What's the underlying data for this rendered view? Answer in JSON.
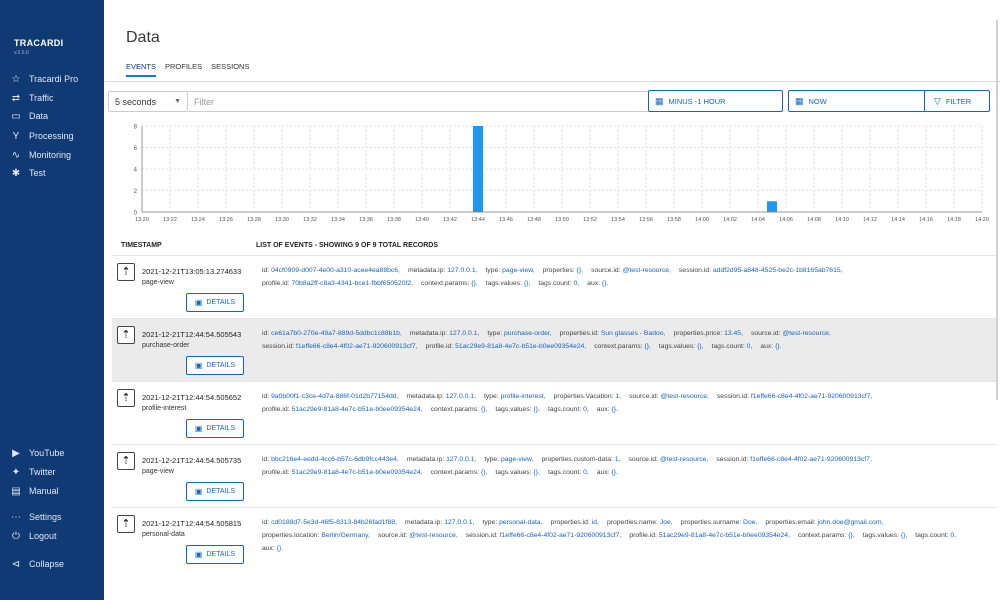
{
  "sidebar": {
    "brand": "TRACARDI",
    "version": "v.0.6.0",
    "items": [
      {
        "label": "Tracardi Pro",
        "icon": "star-icon"
      },
      {
        "label": "Traffic",
        "icon": "traffic-icon"
      },
      {
        "label": "Data",
        "icon": "folder-icon"
      },
      {
        "label": "Processing",
        "icon": "processing-icon"
      },
      {
        "label": "Monitoring",
        "icon": "monitoring-icon"
      },
      {
        "label": "Test",
        "icon": "bug-icon"
      }
    ],
    "bottom_items": [
      {
        "label": "YouTube",
        "icon": "youtube-icon"
      },
      {
        "label": "Twitter",
        "icon": "twitter-icon"
      },
      {
        "label": "Manual",
        "icon": "manual-icon"
      },
      {
        "label": "Settings",
        "icon": "settings-icon"
      },
      {
        "label": "Logout",
        "icon": "logout-icon"
      },
      {
        "label": "Collapse",
        "icon": "collapse-icon"
      }
    ]
  },
  "header": {
    "title": "Data",
    "tabs": [
      "EVENTS",
      "PROFILES",
      "SESSIONS"
    ],
    "active_tab": 0
  },
  "toolbar": {
    "refresh_value": "5 seconds",
    "filter_placeholder": "Filter",
    "from_label": "MINUS -1 HOUR",
    "to_label": "NOW",
    "filter_button": "FILTER"
  },
  "chart_data": {
    "type": "bar",
    "categories": [
      "13:20",
      "13:22",
      "13:24",
      "13:26",
      "13:28",
      "13:30",
      "13:32",
      "13:34",
      "13:36",
      "13:38",
      "13:40",
      "13:42",
      "13:44",
      "13:46",
      "13:48",
      "13:50",
      "13:52",
      "13:54",
      "13:56",
      "13:58",
      "14:00",
      "14:02",
      "14:04",
      "14:06",
      "14:08",
      "14:10",
      "14:12",
      "14:14",
      "14:16",
      "14:18",
      "14:20"
    ],
    "bars": [
      {
        "x": "13:44",
        "value": 8
      },
      {
        "x": "14:05",
        "value": 1
      }
    ],
    "ylim": [
      0,
      8
    ],
    "yticks": [
      0,
      2,
      4,
      6,
      8
    ],
    "grid": true,
    "color": "#2196f3"
  },
  "table": {
    "col_timestamp": "TIMESTAMP",
    "col_events": "LIST OF EVENTS - SHOWING 9 OF 9 TOTAL RECORDS",
    "details_label": "DETAILS",
    "rows": [
      {
        "timestamp": "2021-12-21T13:05:13.274633",
        "type": "page-view",
        "highlight": false,
        "props": [
          {
            "k": "id:",
            "v": "04cf0909-d007-4e00-a310-acee4ea88bc6,"
          },
          {
            "k": "metadata.ip:",
            "v": "127.0.0.1,"
          },
          {
            "k": "type:",
            "v": "page-view,"
          },
          {
            "k": "properties:",
            "v": "{},"
          },
          {
            "k": "source.id:",
            "v": "@test-resource,"
          },
          {
            "k": "session.id:",
            "v": "addf2d95-a848-4525-be2c-1b8165ab7615,"
          },
          {
            "k": "profile.id:",
            "v": "70b8a2ff-c8a3-4341-bce1-fbbf650520f2,"
          },
          {
            "k": "context.params:",
            "v": "{},"
          },
          {
            "k": "tags.values:",
            "v": "{},"
          },
          {
            "k": "tags.count:",
            "v": "0,"
          },
          {
            "k": "aux:",
            "v": "{}."
          }
        ]
      },
      {
        "timestamp": "2021-12-21T12:44:54.505543",
        "type": "purchase-order",
        "highlight": true,
        "props": [
          {
            "k": "id:",
            "v": "ce61a7b0-270e-49a7-889d-5ddbc1c88b1b,"
          },
          {
            "k": "metadata.ip:",
            "v": "127.0.0.1,"
          },
          {
            "k": "type:",
            "v": "purchase-order,"
          },
          {
            "k": "properties.id:",
            "v": "Sun glasses - Badoo,"
          },
          {
            "k": "properties.price:",
            "v": "13.45,"
          },
          {
            "k": "source.id:",
            "v": "@test-resource,"
          },
          {
            "k": "session.id:",
            "v": "f1effe66-c8e4-4f02-ae71-920600913cf7,"
          },
          {
            "k": "profile.id:",
            "v": "51ac29e9-81a8-4e7c-b51e-b0ee09354e24,"
          },
          {
            "k": "context.params:",
            "v": "{},"
          },
          {
            "k": "tags.values:",
            "v": "{},"
          },
          {
            "k": "tags.count:",
            "v": "0,"
          },
          {
            "k": "aux:",
            "v": "{}."
          }
        ]
      },
      {
        "timestamp": "2021-12-21T12:44:54.505652",
        "type": "profile-interest",
        "highlight": false,
        "props": [
          {
            "k": "id:",
            "v": "9a0b00f1-c3ce-4d7a-886f-01d2b77154dd,"
          },
          {
            "k": "metadata.ip:",
            "v": "127.0.0.1,"
          },
          {
            "k": "type:",
            "v": "profile-interest,"
          },
          {
            "k": "properties.Vacation:",
            "v": "1,"
          },
          {
            "k": "source.id:",
            "v": "@test-resource,"
          },
          {
            "k": "session.id:",
            "v": "f1effe66-c8e4-4f02-ae71-920600913cf7,"
          },
          {
            "k": "profile.id:",
            "v": "51ac29e9-81a8-4e7c-b51e-b0ee09354e24,"
          },
          {
            "k": "context.params:",
            "v": "{},"
          },
          {
            "k": "tags.values:",
            "v": "{},"
          },
          {
            "k": "tags.count:",
            "v": "0,"
          },
          {
            "k": "aux:",
            "v": "{}."
          }
        ]
      },
      {
        "timestamp": "2021-12-21T12:44:54.505735",
        "type": "page-view",
        "highlight": false,
        "props": [
          {
            "k": "id:",
            "v": "bbc216e4-eedd-4cc6-b57c-6db9fcc443e4,"
          },
          {
            "k": "metadata.ip:",
            "v": "127.0.0.1,"
          },
          {
            "k": "type:",
            "v": "page-view,"
          },
          {
            "k": "properties.custom-data:",
            "v": "1,"
          },
          {
            "k": "source.id:",
            "v": "@test-resource,"
          },
          {
            "k": "session.id:",
            "v": "f1effe66-c8e4-4f02-ae71-920600913cf7,"
          },
          {
            "k": "profile.id:",
            "v": "51ac29e9-81a8-4e7c-b51e-b0ee09354e24,"
          },
          {
            "k": "context.params:",
            "v": "{},"
          },
          {
            "k": "tags.values:",
            "v": "{},"
          },
          {
            "k": "tags.count:",
            "v": "0,"
          },
          {
            "k": "aux:",
            "v": "{}."
          }
        ]
      },
      {
        "timestamp": "2021-12-21T12:44:54.505815",
        "type": "personal-data",
        "highlight": false,
        "props": [
          {
            "k": "id:",
            "v": "cd0188d7-5e3d-46f5-8313-84b26fad1f88,"
          },
          {
            "k": "metadata.ip:",
            "v": "127.0.0.1,"
          },
          {
            "k": "type:",
            "v": "personal-data,"
          },
          {
            "k": "properties.id:",
            "v": "id,"
          },
          {
            "k": "properties.name:",
            "v": "Joe,"
          },
          {
            "k": "properties.surname:",
            "v": "Doe,"
          },
          {
            "k": "properties.email:",
            "v": "john.doe@gmail.com,"
          },
          {
            "k": "properties.location:",
            "v": "Berlin/Germany,"
          },
          {
            "k": "source.id:",
            "v": "@test-resource,"
          },
          {
            "k": "session.id:",
            "v": "f1effe66-c8e4-4f02-ae71-920600913cf7,"
          },
          {
            "k": "profile.id:",
            "v": "51ac29e9-81a8-4e7c-b51e-b0ee09354e24,"
          },
          {
            "k": "context.params:",
            "v": "{},"
          },
          {
            "k": "tags.values:",
            "v": "{},"
          },
          {
            "k": "tags.count:",
            "v": "0,"
          },
          {
            "k": "aux:",
            "v": "{}."
          }
        ]
      }
    ]
  }
}
